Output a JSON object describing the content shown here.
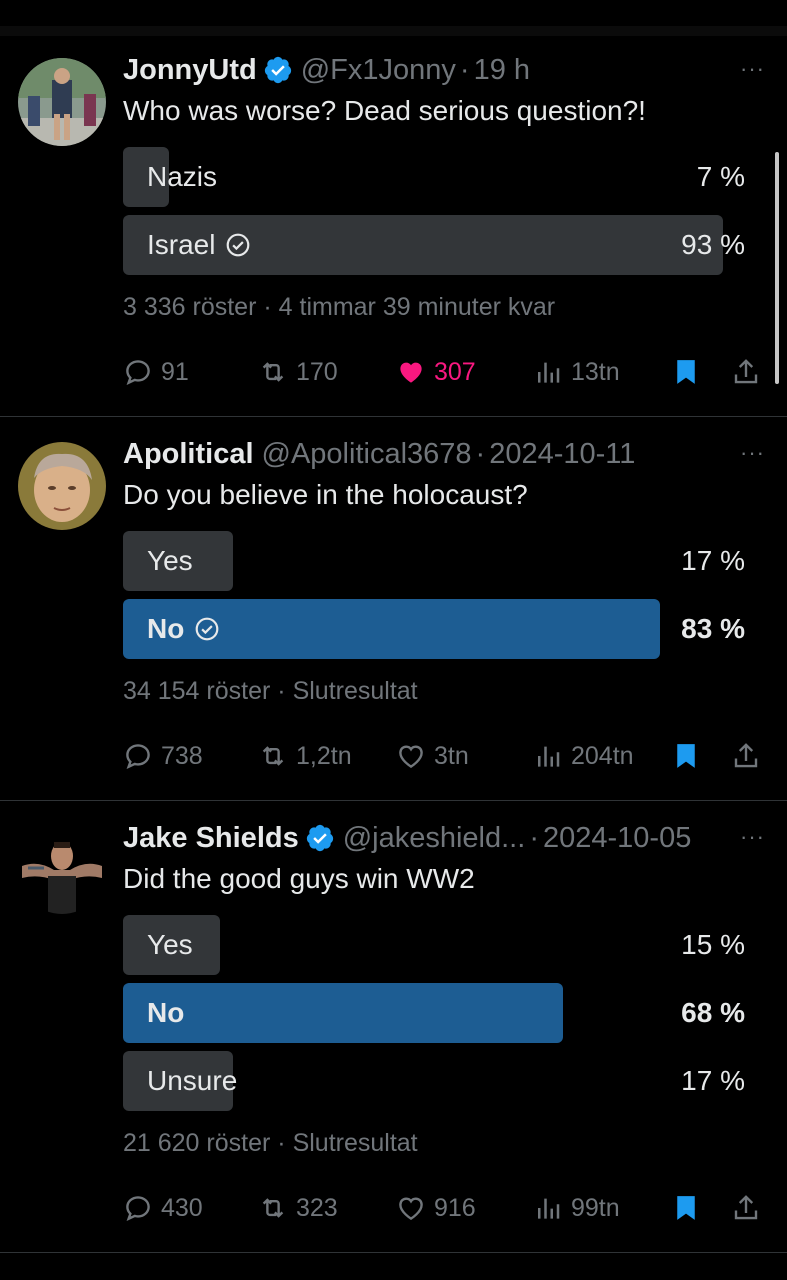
{
  "tweets": [
    {
      "name": "JonnyUtd",
      "verified": true,
      "handle": "@Fx1Jonny",
      "dot": "·",
      "time": "19 h",
      "more": "···",
      "question": "Who was worse? Dead serious question?!",
      "options": [
        {
          "label": "Nazis",
          "pct": "7 %",
          "share": 0.07,
          "winner": false
        },
        {
          "label": "Israel",
          "pct": "93 %",
          "share": 0.93,
          "winner": true,
          "voted": true
        }
      ],
      "votes": "3 336 röster",
      "sep": "·",
      "status": "4 timmar 39 minuter kvar",
      "replies": "91",
      "reposts": "170",
      "likes": "307",
      "liked": true,
      "views": "13tn"
    },
    {
      "name": "Apolitical",
      "verified": false,
      "handle": "@Apolitical3678",
      "dot": "·",
      "time": "2024-10-11",
      "more": "···",
      "question": "Do you believe in the holocaust?",
      "options": [
        {
          "label": "Yes",
          "pct": "17 %",
          "share": 0.17,
          "winner": false
        },
        {
          "label": "No",
          "pct": "83 %",
          "share": 0.83,
          "winner": true,
          "voted": true
        }
      ],
      "votes": "34 154 röster",
      "sep": "·",
      "status": "Slutresultat",
      "replies": "738",
      "reposts": "1,2tn",
      "likes": "3tn",
      "liked": false,
      "views": "204tn"
    },
    {
      "name": "Jake Shields",
      "verified": true,
      "handle": "@jakeshield...",
      "dot": "·",
      "time": "2024-10-05",
      "more": "···",
      "question": "Did the good guys win WW2",
      "options": [
        {
          "label": "Yes",
          "pct": "15 %",
          "share": 0.15,
          "winner": false
        },
        {
          "label": "No",
          "pct": "68 %",
          "share": 0.68,
          "winner": true
        },
        {
          "label": "Unsure",
          "pct": "17 %",
          "share": 0.17,
          "winner": false
        }
      ],
      "votes": "21 620 röster",
      "sep": "·",
      "status": "Slutresultat",
      "replies": "430",
      "reposts": "323",
      "likes": "916",
      "liked": false,
      "views": "99tn"
    }
  ],
  "colors": {
    "background": "#000000",
    "text": "#e7e9ea",
    "muted": "#71767b",
    "verified": "#1d9bf0",
    "like": "#f91880",
    "bookmark": "#1d9bf0",
    "poll_bar": "#333639",
    "poll_winner": "#1d5d93"
  },
  "icons": {
    "verified": "verified-badge-icon",
    "reply": "reply-icon",
    "repost": "repost-icon",
    "like": "heart-icon",
    "views": "views-icon",
    "bookmark": "bookmark-icon",
    "share": "share-icon",
    "voted": "voted-check-icon",
    "more": "more-icon"
  }
}
